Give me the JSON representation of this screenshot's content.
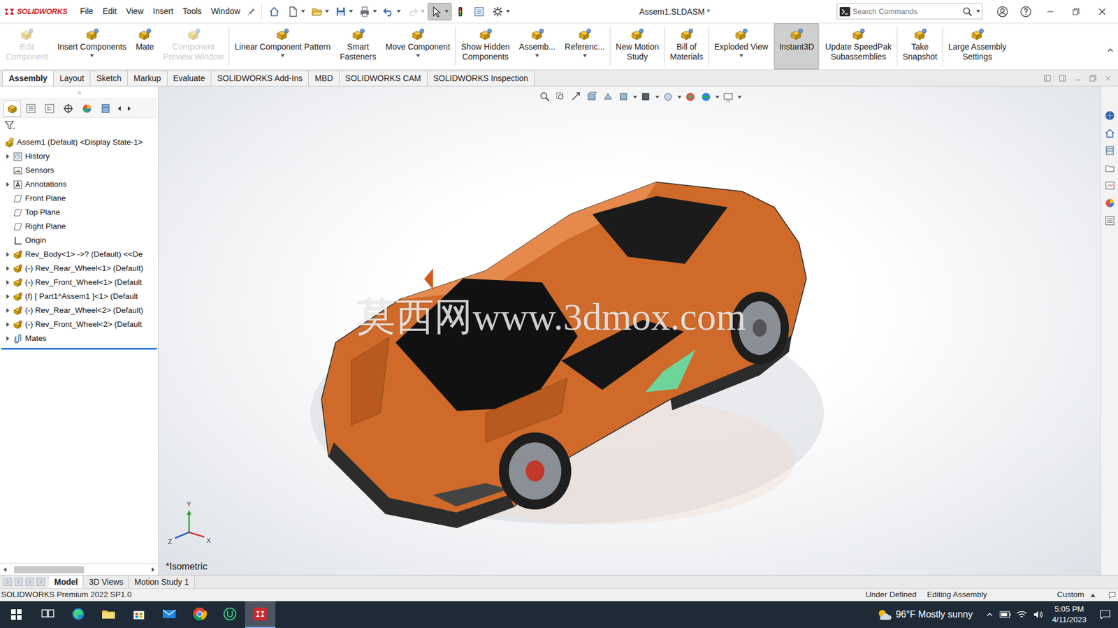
{
  "app": {
    "logo": "SOLIDWORKS",
    "menu": [
      "File",
      "Edit",
      "View",
      "Insert",
      "Tools",
      "Window"
    ],
    "title": "Assem1.SLDASM *",
    "search_placeholder": "Search Commands"
  },
  "quick_access": [
    {
      "kind": "home",
      "selected": false,
      "disabled": false,
      "dropdown": false
    },
    {
      "kind": "new",
      "selected": false,
      "disabled": false,
      "dropdown": true
    },
    {
      "kind": "open",
      "selected": false,
      "disabled": false,
      "dropdown": true
    },
    {
      "kind": "save",
      "selected": false,
      "disabled": false,
      "dropdown": true
    },
    {
      "kind": "print",
      "selected": false,
      "disabled": false,
      "dropdown": true
    },
    {
      "kind": "undo",
      "selected": false,
      "disabled": false,
      "dropdown": true
    },
    {
      "kind": "redo",
      "selected": false,
      "disabled": true,
      "dropdown": true
    },
    {
      "kind": "select",
      "selected": true,
      "disabled": false,
      "dropdown": true
    },
    {
      "kind": "rebuild",
      "selected": false,
      "disabled": false,
      "dropdown": false
    },
    {
      "kind": "filemgmt",
      "selected": false,
      "disabled": false,
      "dropdown": false
    },
    {
      "kind": "options",
      "selected": false,
      "disabled": false,
      "dropdown": true
    }
  ],
  "ribbon": {
    "groups": [
      {
        "buttons": [
          {
            "lines": [
              "Edit",
              "Component"
            ],
            "disabled": true,
            "selected": false,
            "dropdown": false
          },
          {
            "lines": [
              "Insert Components"
            ],
            "disabled": false,
            "selected": false,
            "dropdown": true
          },
          {
            "lines": [
              "Mate"
            ],
            "disabled": false,
            "selected": false,
            "dropdown": false
          },
          {
            "lines": [
              "Component",
              "Preview Window"
            ],
            "disabled": true,
            "selected": false,
            "dropdown": false
          }
        ]
      },
      {
        "buttons": [
          {
            "lines": [
              "Linear Component Pattern"
            ],
            "disabled": false,
            "selected": false,
            "dropdown": true
          },
          {
            "lines": [
              "Smart",
              "Fasteners"
            ],
            "disabled": false,
            "selected": false,
            "dropdown": false
          },
          {
            "lines": [
              "Move Component"
            ],
            "disabled": false,
            "selected": false,
            "dropdown": true
          }
        ]
      },
      {
        "buttons": [
          {
            "lines": [
              "Show Hidden",
              "Components"
            ],
            "disabled": false,
            "selected": false,
            "dropdown": false
          },
          {
            "lines": [
              "Assemb..."
            ],
            "disabled": false,
            "selected": false,
            "dropdown": true
          },
          {
            "lines": [
              "Referenc..."
            ],
            "disabled": false,
            "selected": false,
            "dropdown": true
          }
        ]
      },
      {
        "buttons": [
          {
            "lines": [
              "New Motion",
              "Study"
            ],
            "disabled": false,
            "selected": false,
            "dropdown": false
          }
        ]
      },
      {
        "buttons": [
          {
            "lines": [
              "Bill of",
              "Materials"
            ],
            "disabled": false,
            "selected": false,
            "dropdown": false
          }
        ]
      },
      {
        "buttons": [
          {
            "lines": [
              "Exploded View"
            ],
            "disabled": false,
            "selected": false,
            "dropdown": true
          }
        ]
      },
      {
        "buttons": [
          {
            "lines": [
              "Instant3D"
            ],
            "disabled": false,
            "selected": true,
            "dropdown": false
          }
        ]
      },
      {
        "buttons": [
          {
            "lines": [
              "Update SpeedPak",
              "Subassemblies"
            ],
            "disabled": false,
            "selected": false,
            "dropdown": false
          }
        ]
      },
      {
        "buttons": [
          {
            "lines": [
              "Take",
              "Snapshot"
            ],
            "disabled": false,
            "selected": false,
            "dropdown": false
          }
        ]
      },
      {
        "buttons": [
          {
            "lines": [
              "Large Assembly",
              "Settings"
            ],
            "disabled": false,
            "selected": false,
            "dropdown": false
          }
        ]
      }
    ]
  },
  "tabs": [
    {
      "label": "Assembly",
      "selected": true
    },
    {
      "label": "Layout",
      "selected": false
    },
    {
      "label": "Sketch",
      "selected": false
    },
    {
      "label": "Markup",
      "selected": false
    },
    {
      "label": "Evaluate",
      "selected": false
    },
    {
      "label": "SOLIDWORKS Add-Ins",
      "selected": false
    },
    {
      "label": "MBD",
      "selected": false
    },
    {
      "label": "SOLIDWORKS CAM",
      "selected": false
    },
    {
      "label": "SOLIDWORKS Inspection",
      "selected": false
    }
  ],
  "tree": {
    "items": [
      {
        "label": "Assem1 (Default) <Display State-1>",
        "kind": "assembly",
        "expandable": false,
        "depth": 0
      },
      {
        "label": "History",
        "kind": "history",
        "expandable": true,
        "depth": 1
      },
      {
        "label": "Sensors",
        "kind": "sensor",
        "expandable": false,
        "depth": 1
      },
      {
        "label": "Annotations",
        "kind": "annotation",
        "expandable": true,
        "depth": 1
      },
      {
        "label": "Front Plane",
        "kind": "plane",
        "expandable": false,
        "depth": 1
      },
      {
        "label": "Top Plane",
        "kind": "plane",
        "expandable": false,
        "depth": 1
      },
      {
        "label": "Right Plane",
        "kind": "plane",
        "expandable": false,
        "depth": 1
      },
      {
        "label": "Origin",
        "kind": "origin",
        "expandable": false,
        "depth": 1
      },
      {
        "label": "Rev_Body<1> ->? (Default) <<De",
        "kind": "part",
        "expandable": true,
        "depth": 1
      },
      {
        "label": "(-) Rev_Rear_Wheel<1> (Default)",
        "kind": "part",
        "expandable": true,
        "depth": 1
      },
      {
        "label": "(-) Rev_Front_Wheel<1> (Default",
        "kind": "part",
        "expandable": true,
        "depth": 1
      },
      {
        "label": "(f) [ Part1^Assem1 ]<1> (Default",
        "kind": "part",
        "expandable": true,
        "depth": 1
      },
      {
        "label": "(-) Rev_Rear_Wheel<2> (Default)",
        "kind": "part",
        "expandable": true,
        "depth": 1
      },
      {
        "label": "(-) Rev_Front_Wheel<2> (Default",
        "kind": "part",
        "expandable": true,
        "depth": 1
      },
      {
        "label": "Mates",
        "kind": "mates",
        "expandable": true,
        "depth": 1
      }
    ]
  },
  "viewport": {
    "watermark": "莫西网www.3dmox.com",
    "view_name": "*Isometric",
    "triad": {
      "x": "X",
      "y": "Y",
      "z": "Z"
    }
  },
  "bottom_tabs": [
    {
      "label": "Model",
      "selected": true
    },
    {
      "label": "3D Views",
      "selected": false
    },
    {
      "label": "Motion Study 1",
      "selected": false
    }
  ],
  "status_bar": {
    "product": "SOLIDWORKS Premium 2022 SP1.0",
    "state": "Under Defined",
    "mode": "Editing Assembly",
    "units": "Custom"
  },
  "taskbar": {
    "apps": [
      {
        "kind": "taskview",
        "selected": false
      },
      {
        "kind": "edge",
        "selected": false
      },
      {
        "kind": "explorer",
        "selected": false
      },
      {
        "kind": "store",
        "selected": false
      },
      {
        "kind": "mail",
        "selected": false
      },
      {
        "kind": "chrome",
        "selected": false
      },
      {
        "kind": "upwork",
        "selected": false
      },
      {
        "kind": "solidworks",
        "selected": true
      }
    ],
    "weather": "96°F Mostly sunny",
    "time": "5:05 PM",
    "date": "4/11/2023"
  }
}
